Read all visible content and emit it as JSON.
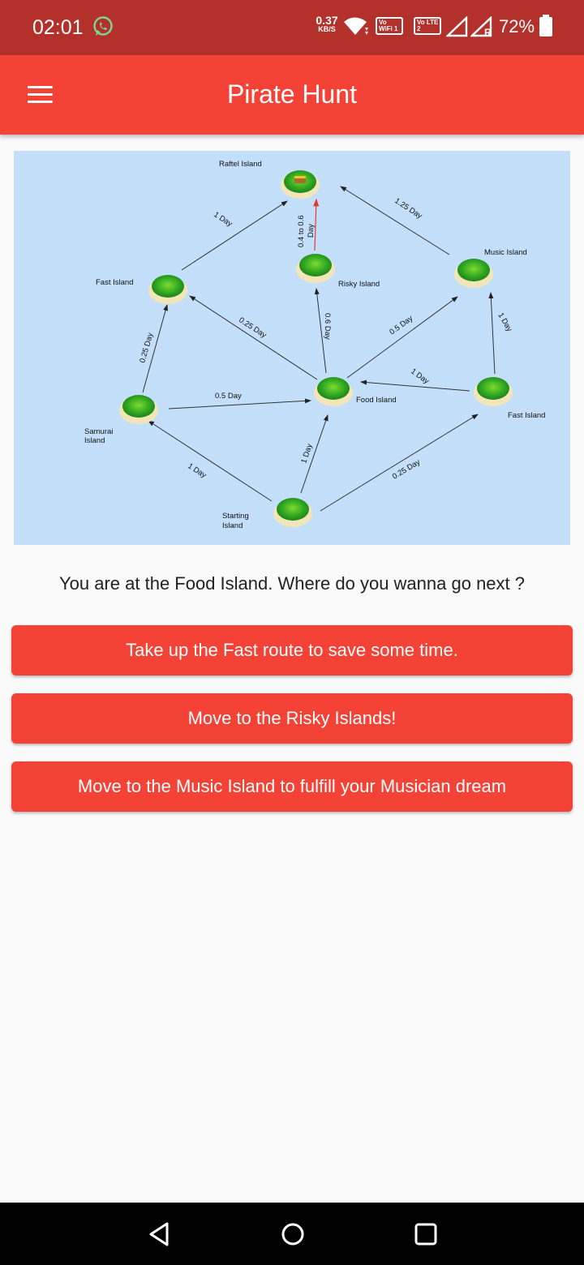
{
  "status_bar": {
    "time": "02:01",
    "net_speed_value": "0.37",
    "net_speed_unit": "KB/S",
    "volte_wifi": "Vo WiFi 1",
    "volte_lte": "Vo LTE 2",
    "battery": "72%",
    "roaming": "R",
    "icons": [
      "whatsapp-icon",
      "wifi-icon",
      "signal-icon",
      "battery-icon"
    ]
  },
  "app_bar": {
    "title": "Pirate Hunt",
    "menu_icon": "hamburger-menu-icon"
  },
  "map": {
    "islands": [
      {
        "id": "raftel",
        "label": "Raftel Island"
      },
      {
        "id": "risky",
        "label": "Risky Island"
      },
      {
        "id": "music",
        "label": "Music Island"
      },
      {
        "id": "fast-left",
        "label": "Fast Island"
      },
      {
        "id": "food",
        "label": "Food Island"
      },
      {
        "id": "fast-right",
        "label": "Fast Island"
      },
      {
        "id": "samurai",
        "label": "Samurai Island"
      },
      {
        "id": "start",
        "label": "Starting Island"
      }
    ],
    "routes": [
      {
        "from": "fast-left",
        "to": "raftel",
        "label": "1 Day"
      },
      {
        "from": "music",
        "to": "raftel",
        "label": "1.25 Day"
      },
      {
        "from": "risky",
        "to": "raftel",
        "label": "0.4 to 0.6 Day"
      },
      {
        "from": "food",
        "to": "fast-left",
        "label": "0.25 Day"
      },
      {
        "from": "food",
        "to": "risky",
        "label": "0.6 Day"
      },
      {
        "from": "food",
        "to": "music",
        "label": "0.5 Day"
      },
      {
        "from": "fast-right",
        "to": "music",
        "label": "1 Day"
      },
      {
        "from": "samurai",
        "to": "fast-left",
        "label": "0.25 Day"
      },
      {
        "from": "samurai",
        "to": "food",
        "label": "0.5 Day"
      },
      {
        "from": "fast-right",
        "to": "food",
        "label": "1 Day"
      },
      {
        "from": "start",
        "to": "samurai",
        "label": "1 Day"
      },
      {
        "from": "start",
        "to": "food",
        "label": "1 Day"
      },
      {
        "from": "start",
        "to": "fast-right",
        "label": "0.25 Day"
      }
    ]
  },
  "prompt": "You are at the Food Island. Where do you wanna go next ?",
  "choices": [
    "Take up the Fast route to save some time.",
    "Move to the Risky Islands!",
    "Move to the Music Island to fulfill your Musician dream"
  ],
  "colors": {
    "status_bar": "#b3312a",
    "app_bar": "#f44336",
    "button": "#f44336",
    "map_water": "#c4dff9",
    "background": "#fafafa"
  },
  "nav_bar": {
    "buttons": [
      "back-icon",
      "home-icon",
      "recents-icon"
    ]
  }
}
